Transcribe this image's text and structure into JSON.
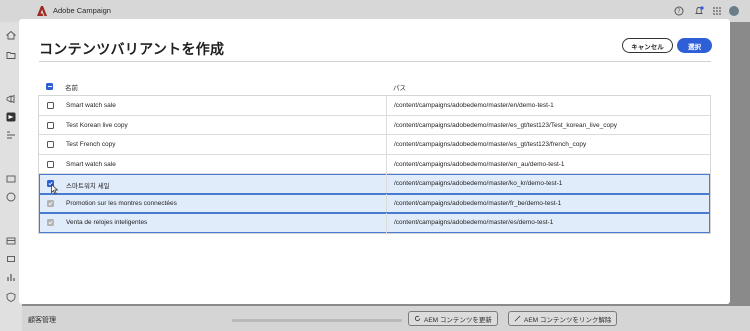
{
  "app": {
    "title": "Adobe Campaign"
  },
  "modal": {
    "title": "コンテンツバリアントを作成",
    "cancel_label": "キャンセル",
    "select_label": "選択"
  },
  "table": {
    "columns": {
      "name": "名前",
      "path": "パス"
    },
    "rows": [
      {
        "name": "Smart watch sale",
        "path": "/content/campaigns/adobedemo/master/en/demo-test-1",
        "state": "unchecked"
      },
      {
        "name": "Test Korean live copy",
        "path": "/content/campaigns/adobedemo/master/es_gt/test123/Test_korean_live_copy",
        "state": "unchecked"
      },
      {
        "name": "Test French copy",
        "path": "/content/campaigns/adobedemo/master/es_gt/test123/french_copy",
        "state": "unchecked"
      },
      {
        "name": "Smart watch sale",
        "path": "/content/campaigns/adobedemo/master/en_au/demo-test-1",
        "state": "unchecked"
      },
      {
        "name": "스마트워치 세일",
        "path": "/content/campaigns/adobedemo/master/ko_kr/demo-test-1",
        "state": "checked"
      },
      {
        "name": "Promotion sur les montres connectées",
        "path": "/content/campaigns/adobedemo/master/fr_be/demo-test-1",
        "state": "checked-disabled"
      },
      {
        "name": "Venta de relojes inteligentes",
        "path": "/content/campaigns/adobedemo/master/es/demo-test-1",
        "state": "checked-disabled"
      }
    ]
  },
  "background": {
    "bottom_label": "顧客管理",
    "update_button": "AEM コンテンツを更新",
    "unlink_button": "AEM コンテンツをリンク解除"
  },
  "colors": {
    "accent": "#2e5fd6",
    "selected_row": "#e1ecfa",
    "brand_red": "#eb1000"
  },
  "icons": [
    "adobe-logo-icon",
    "help-icon",
    "bell-icon",
    "apps-grid-icon",
    "avatar",
    "home-icon",
    "folder-icon",
    "cursor-icon",
    "checkmark-icon"
  ]
}
